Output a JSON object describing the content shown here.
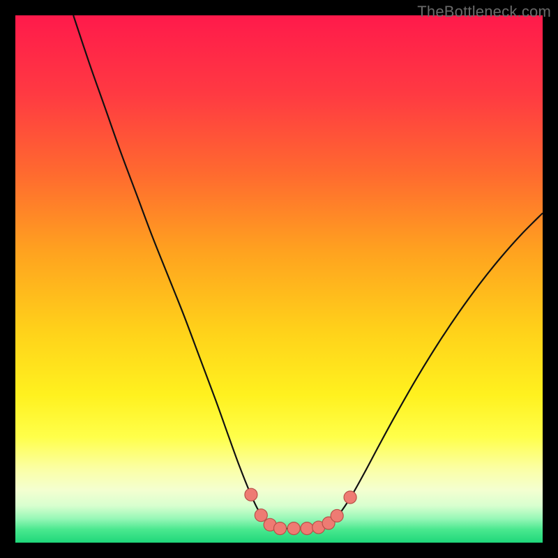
{
  "watermark": "TheBottleneck.com",
  "chart_data": {
    "type": "line",
    "title": "",
    "xlabel": "",
    "ylabel": "",
    "xlim": [
      0,
      100
    ],
    "ylim": [
      0,
      100
    ],
    "gradient_stops": [
      {
        "offset": 0.0,
        "color": "#ff1a4b"
      },
      {
        "offset": 0.15,
        "color": "#ff3a42"
      },
      {
        "offset": 0.3,
        "color": "#ff6a2f"
      },
      {
        "offset": 0.45,
        "color": "#ffa31f"
      },
      {
        "offset": 0.6,
        "color": "#ffd21a"
      },
      {
        "offset": 0.72,
        "color": "#fff11f"
      },
      {
        "offset": 0.8,
        "color": "#ffff4a"
      },
      {
        "offset": 0.86,
        "color": "#fbffa5"
      },
      {
        "offset": 0.9,
        "color": "#f4ffd0"
      },
      {
        "offset": 0.93,
        "color": "#d8ffcf"
      },
      {
        "offset": 0.955,
        "color": "#95f7b6"
      },
      {
        "offset": 0.975,
        "color": "#4ae88f"
      },
      {
        "offset": 1.0,
        "color": "#1fd77a"
      }
    ],
    "curve_points": [
      {
        "x": 11.0,
        "y": 100.0
      },
      {
        "x": 14.0,
        "y": 91.0
      },
      {
        "x": 17.0,
        "y": 82.5
      },
      {
        "x": 20.0,
        "y": 74.0
      },
      {
        "x": 23.0,
        "y": 66.0
      },
      {
        "x": 26.0,
        "y": 58.0
      },
      {
        "x": 29.0,
        "y": 50.5
      },
      {
        "x": 32.0,
        "y": 43.0
      },
      {
        "x": 35.0,
        "y": 35.0
      },
      {
        "x": 38.0,
        "y": 27.0
      },
      {
        "x": 40.5,
        "y": 20.0
      },
      {
        "x": 42.5,
        "y": 14.5
      },
      {
        "x": 44.5,
        "y": 9.5
      },
      {
        "x": 46.0,
        "y": 6.3
      },
      {
        "x": 47.5,
        "y": 4.2
      },
      {
        "x": 49.0,
        "y": 3.1
      },
      {
        "x": 51.0,
        "y": 2.7
      },
      {
        "x": 53.0,
        "y": 2.7
      },
      {
        "x": 55.0,
        "y": 2.7
      },
      {
        "x": 57.0,
        "y": 2.8
      },
      {
        "x": 58.8,
        "y": 3.3
      },
      {
        "x": 60.5,
        "y": 4.4
      },
      {
        "x": 62.0,
        "y": 6.2
      },
      {
        "x": 64.0,
        "y": 9.3
      },
      {
        "x": 66.5,
        "y": 13.8
      },
      {
        "x": 69.0,
        "y": 18.5
      },
      {
        "x": 72.0,
        "y": 24.0
      },
      {
        "x": 76.0,
        "y": 31.0
      },
      {
        "x": 80.0,
        "y": 37.5
      },
      {
        "x": 84.0,
        "y": 43.5
      },
      {
        "x": 88.0,
        "y": 49.0
      },
      {
        "x": 92.0,
        "y": 54.0
      },
      {
        "x": 96.0,
        "y": 58.5
      },
      {
        "x": 100.0,
        "y": 62.5
      }
    ],
    "markers": [
      {
        "x": 44.7,
        "y": 9.1
      },
      {
        "x": 46.6,
        "y": 5.2
      },
      {
        "x": 48.3,
        "y": 3.4
      },
      {
        "x": 50.2,
        "y": 2.7
      },
      {
        "x": 52.8,
        "y": 2.7
      },
      {
        "x": 55.3,
        "y": 2.7
      },
      {
        "x": 57.5,
        "y": 2.9
      },
      {
        "x": 59.4,
        "y": 3.7
      },
      {
        "x": 61.0,
        "y": 5.1
      },
      {
        "x": 63.5,
        "y": 8.6
      }
    ],
    "marker_style": {
      "fill": "#ee7b73",
      "stroke": "#b85048",
      "r": 9
    },
    "curve_stroke": "#111111",
    "curve_width": 2.2
  }
}
